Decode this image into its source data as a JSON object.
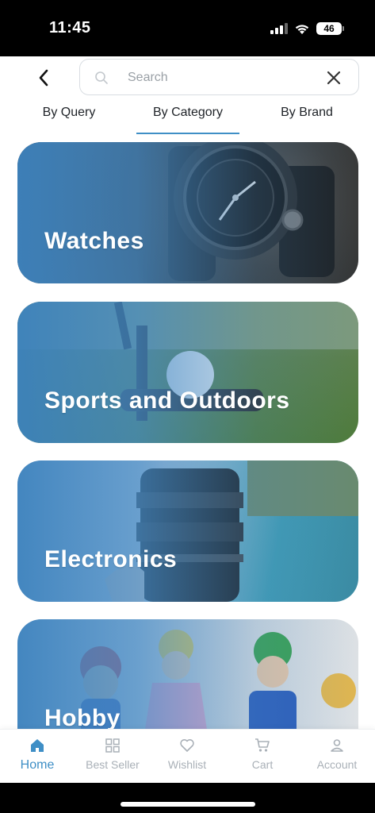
{
  "status_bar": {
    "time": "11:45",
    "battery": "46",
    "icons": [
      "signal-icon",
      "wifi-icon",
      "battery-icon"
    ]
  },
  "search": {
    "placeholder": "Search",
    "value": ""
  },
  "tabs": [
    {
      "label": "By Query",
      "active": false
    },
    {
      "label": "By Category",
      "active": true
    },
    {
      "label": "By Brand",
      "active": false
    }
  ],
  "categories": [
    {
      "label": "Watches"
    },
    {
      "label": "Sports and Outdoors"
    },
    {
      "label": "Electronics"
    },
    {
      "label": "Hobby"
    }
  ],
  "bottom_nav": [
    {
      "label": "Home",
      "icon": "home-icon",
      "active": true
    },
    {
      "label": "Best Seller",
      "icon": "grid-icon",
      "active": false
    },
    {
      "label": "Wishlist",
      "icon": "heart-icon",
      "active": false
    },
    {
      "label": "Cart",
      "icon": "cart-icon",
      "active": false
    },
    {
      "label": "Account",
      "icon": "user-icon",
      "active": false
    }
  ],
  "colors": {
    "accent": "#3f8fc6",
    "inactive": "#a9b0b7"
  }
}
